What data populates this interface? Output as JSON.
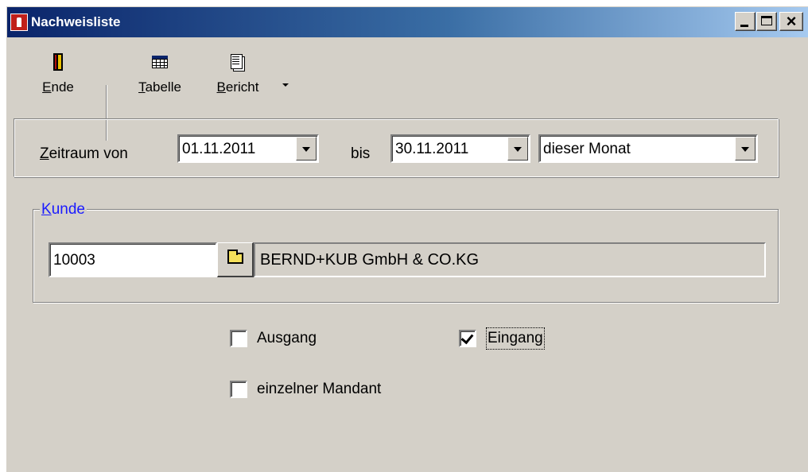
{
  "window": {
    "title": "Nachweisliste",
    "close_glyph": "×"
  },
  "toolbar": {
    "ende": {
      "accel": "E",
      "rest": "nde",
      "icon": "exit-door-icon"
    },
    "tabelle": {
      "accel": "T",
      "rest": "abelle",
      "icon": "table-icon"
    },
    "bericht": {
      "accel": "B",
      "rest": "ericht",
      "icon": "report-icon"
    }
  },
  "zeitraum": {
    "label_accel": "Z",
    "label_rest": "eitraum von",
    "from_value": "01.11.2011",
    "to_label": "bis",
    "to_value": "30.11.2011",
    "period_value": "dieser Monat"
  },
  "kunde": {
    "legend_accel": "K",
    "legend_rest": "unde",
    "number": "10003",
    "name": "BERND+KUB GmbH & CO.KG"
  },
  "options": {
    "ausgang": {
      "label": "Ausgang",
      "checked": false
    },
    "eingang": {
      "label": "Eingang",
      "checked": true
    },
    "einzelner_mandant": {
      "label": "einzelner Mandant",
      "checked": false
    }
  },
  "colors": {
    "titlebar_start": "#0a246a",
    "titlebar_end": "#a6caf0",
    "face": "#d4d0c8",
    "legend_text": "#1a1aff"
  }
}
